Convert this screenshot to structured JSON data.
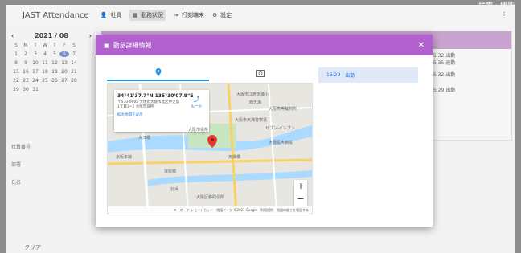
{
  "corner_label": "検索・機能",
  "app": {
    "title": "JAST Attendance",
    "nav": [
      {
        "label": "社員",
        "icon": "user-icon"
      },
      {
        "label": "勤務状況",
        "icon": "calendar-icon"
      },
      {
        "label": "打刻端末",
        "icon": "terminal-icon"
      },
      {
        "label": "設定",
        "icon": "gear-icon"
      }
    ]
  },
  "calendar": {
    "month": "2021 / 08",
    "weekdays": [
      "S",
      "M",
      "T",
      "W",
      "T",
      "F",
      "S"
    ],
    "days": [
      "1",
      "2",
      "3",
      "4",
      "5",
      "6",
      "7",
      "8",
      "9",
      "10",
      "11",
      "12",
      "13",
      "14",
      "15",
      "16",
      "17",
      "18",
      "19",
      "20",
      "21",
      "22",
      "23",
      "24",
      "25",
      "26",
      "27",
      "28",
      "29",
      "30",
      "31"
    ],
    "today": "6"
  },
  "filters": {
    "employee_no": "社員番号",
    "department": "部署",
    "name": "氏名"
  },
  "clear_label": "クリア",
  "bg_rows": [
    "15:32 出勤",
    "15:35 退勤",
    "15:32 出勤",
    "15:29 出勤"
  ],
  "modal": {
    "title": "勤怠詳細情報",
    "tabs": [
      {
        "icon": "location-pin-icon",
        "active": true
      },
      {
        "icon": "image-icon",
        "active": false
      }
    ],
    "map": {
      "coords": "34°41'37.7\"N 135°30'07.9\"E",
      "address_line1": "〒530-0005 大阪府大阪市北区中之島",
      "address_line2": "1丁目3−1 大阪市役所",
      "route_label": "ルート",
      "larger_map_link": "拡大地図を表示",
      "labels": [
        "大阪市江西天満小",
        "西天満",
        "大阪高等裁判所",
        "大阪市天満警察署",
        "セブン-イレブン",
        "大阪市役所",
        "大江橋",
        "京阪本線",
        "天満橋",
        "大阪医大病院",
        "淀屋橋",
        "北浜",
        "大阪証券取引所"
      ],
      "footer": [
        "キーボード ショートカット",
        "地図データ ©2021 Google",
        "利用規約",
        "地図の誤りを報告する"
      ],
      "zoom_in": "+",
      "zoom_out": "−"
    },
    "entries": [
      {
        "time": "15:29",
        "type": "出勤"
      }
    ]
  }
}
